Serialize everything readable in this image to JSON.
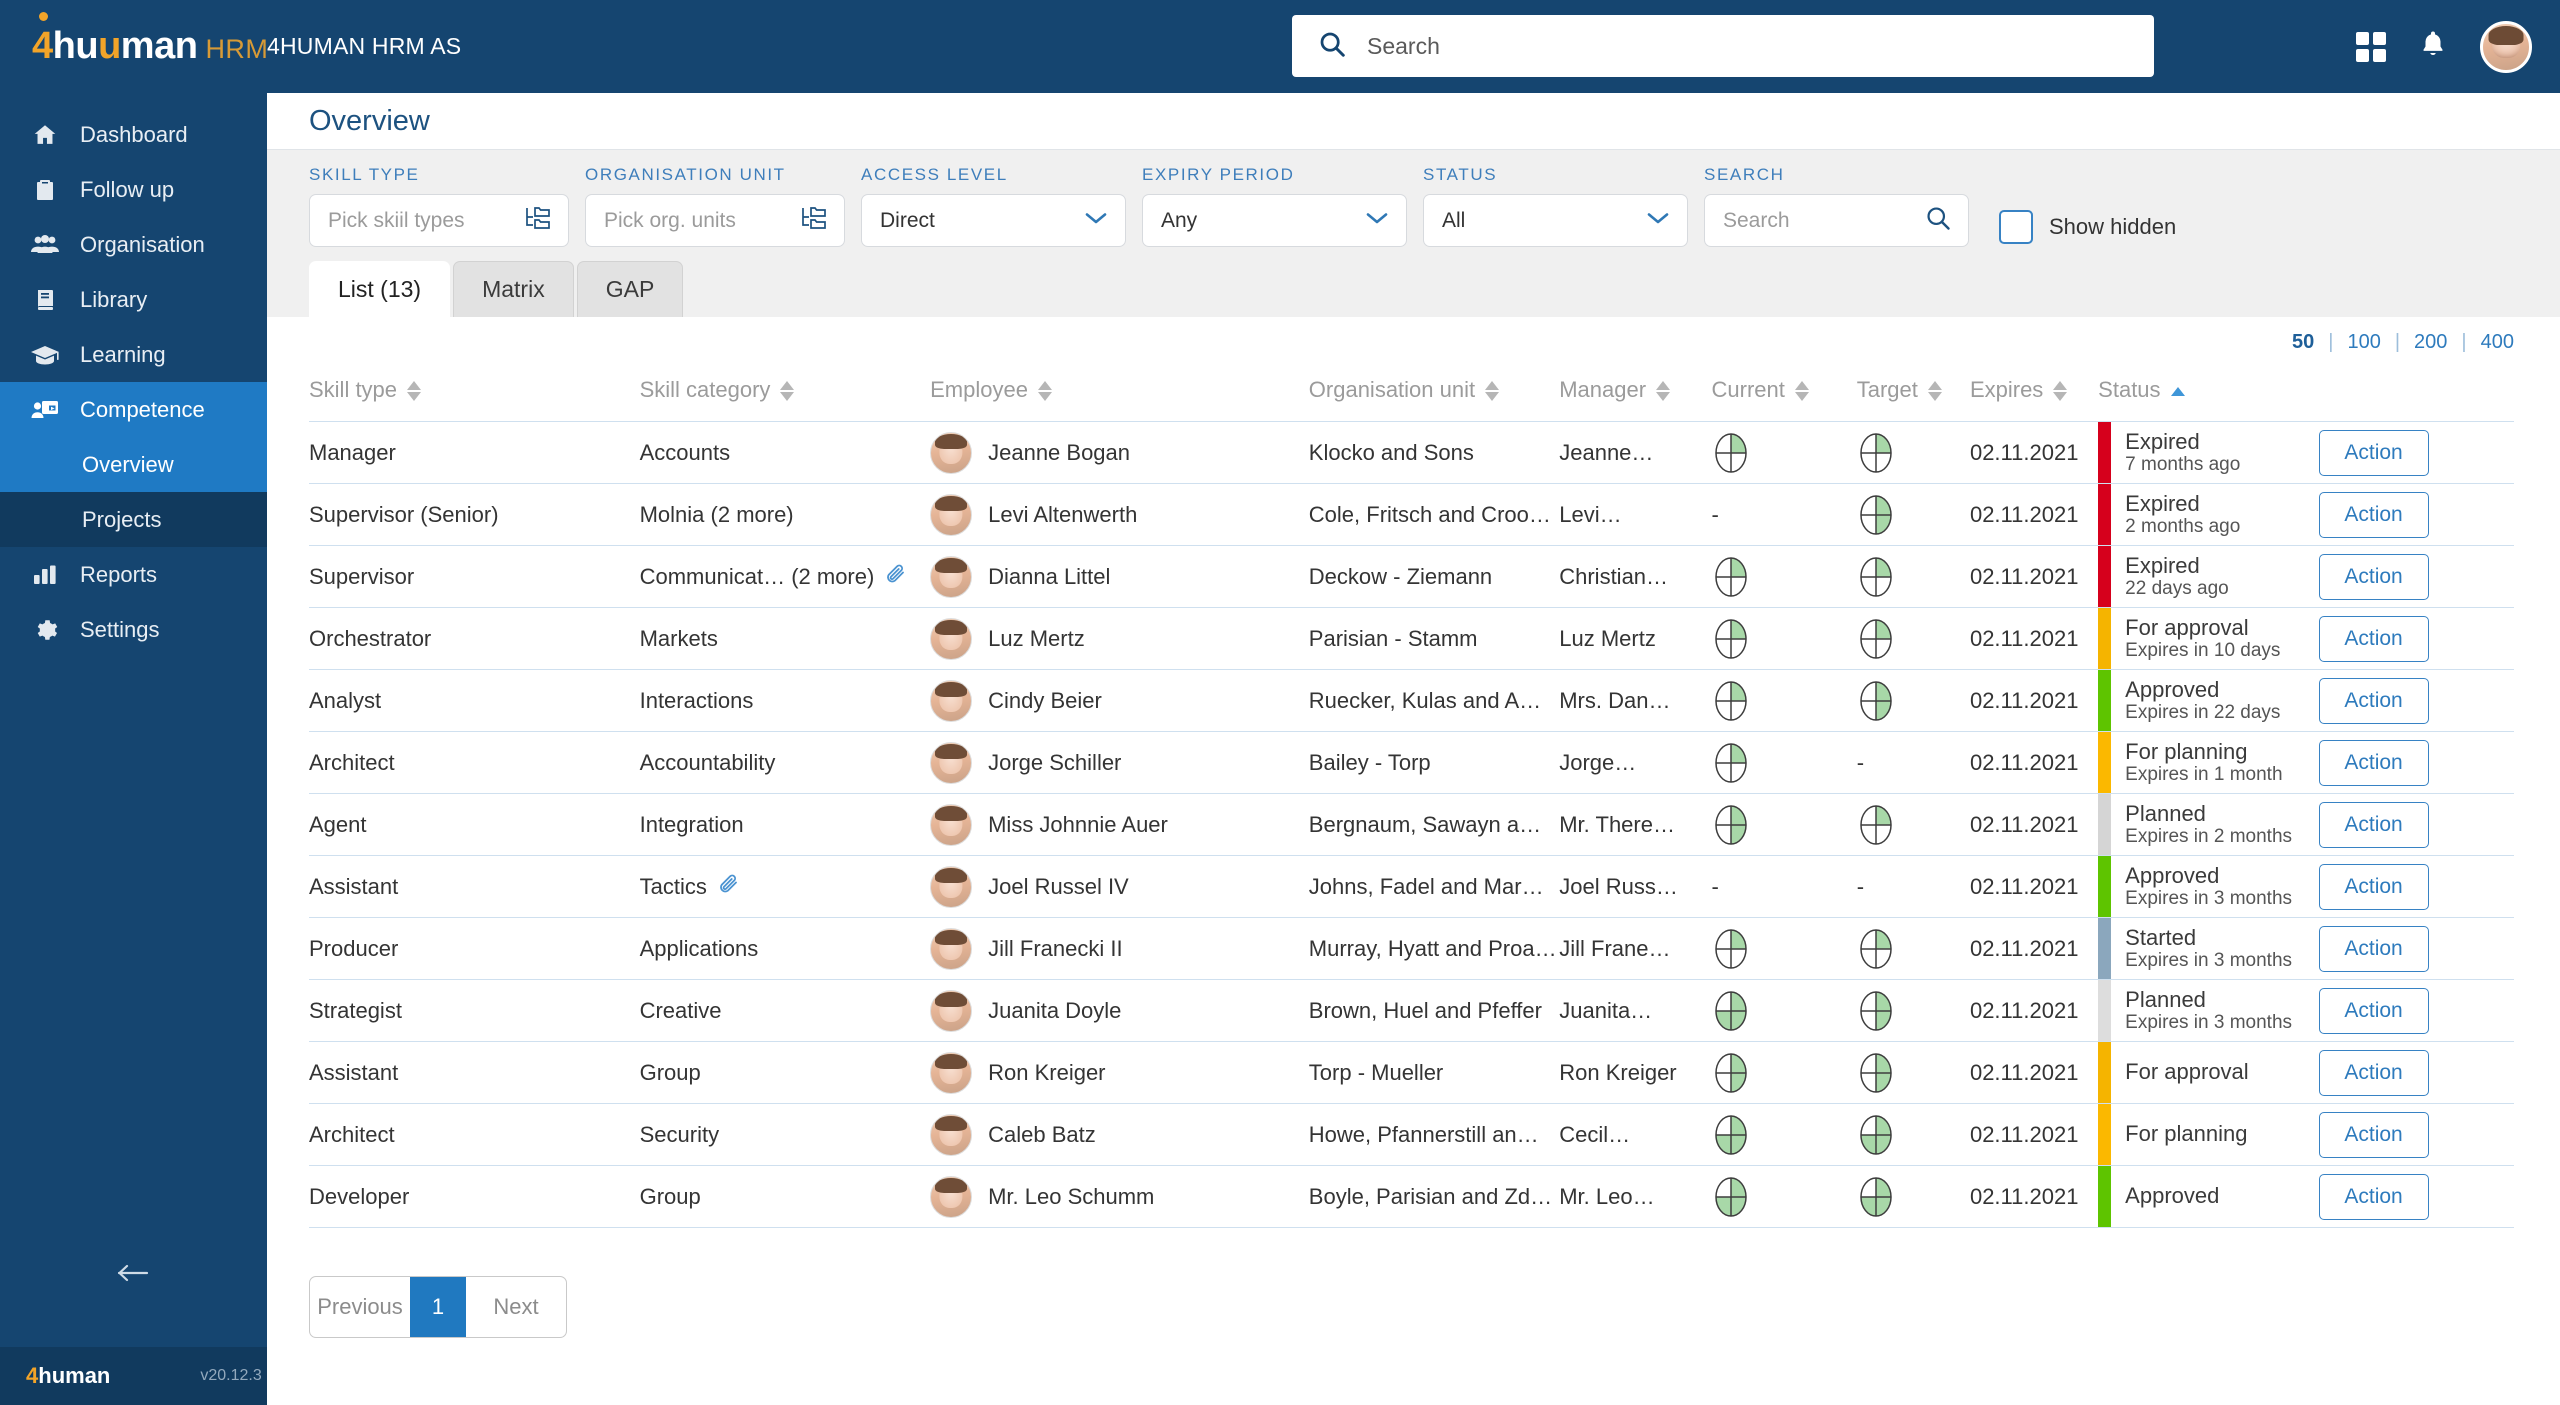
{
  "topbar": {
    "logo": {
      "four": "4",
      "hu": "hu",
      "u": "u",
      "man": "man",
      "hrm": "HRM"
    },
    "company": "4HUMAN HRM AS",
    "search_placeholder": "Search",
    "search_icon": "search-icon",
    "apps_icon": "grid-apps-icon",
    "bell_icon": "notification-bell-icon",
    "avatar": "user-avatar"
  },
  "sidebar": {
    "items": [
      {
        "label": "Dashboard",
        "icon": "home-icon",
        "active": false
      },
      {
        "label": "Follow up",
        "icon": "clipboard-icon",
        "active": false
      },
      {
        "label": "Organisation",
        "icon": "people-icon",
        "active": false
      },
      {
        "label": "Library",
        "icon": "book-icon",
        "active": false
      },
      {
        "label": "Learning",
        "icon": "graduation-cap-icon",
        "active": false
      },
      {
        "label": "Competence",
        "icon": "competence-icon",
        "active": true
      }
    ],
    "sub_items": [
      {
        "label": "Overview",
        "active": true
      },
      {
        "label": "Projects",
        "active": false
      }
    ],
    "items_after": [
      {
        "label": "Reports",
        "icon": "bar-chart-icon",
        "active": false
      },
      {
        "label": "Settings",
        "icon": "gear-icon",
        "active": false
      }
    ],
    "collapse_icon": "arrow-left-icon",
    "footer": {
      "logo_four": "4",
      "logo_human": "human",
      "version": "v20.12.3"
    }
  },
  "page": {
    "title": "Overview"
  },
  "filters": [
    {
      "label": "SKILL TYPE",
      "type": "picker",
      "placeholder": "Pick skiil types",
      "value": "",
      "icon": "tree-folder-icon",
      "name": "skill-type-filter"
    },
    {
      "label": "ORGANISATION UNIT",
      "type": "picker",
      "placeholder": "Pick org. units",
      "value": "",
      "icon": "tree-folder-icon",
      "name": "organisation-unit-filter"
    },
    {
      "label": "ACCESS LEVEL",
      "type": "select",
      "value": "Direct",
      "icon": "chevron-down-icon",
      "name": "access-level-filter"
    },
    {
      "label": "EXPIRY PERIOD",
      "type": "select",
      "value": "Any",
      "icon": "chevron-down-icon",
      "name": "expiry-period-filter"
    },
    {
      "label": "STATUS",
      "type": "select",
      "value": "All",
      "icon": "chevron-down-icon",
      "name": "status-filter"
    },
    {
      "label": "SEARCH",
      "type": "search",
      "placeholder": "Search",
      "value": "",
      "icon": "search-icon",
      "name": "search-filter"
    }
  ],
  "show_hidden": {
    "label": "Show hidden",
    "checked": false
  },
  "tabs": [
    {
      "label": "List (13)",
      "active": true
    },
    {
      "label": "Matrix",
      "active": false
    },
    {
      "label": "GAP",
      "active": false
    }
  ],
  "page_sizes": {
    "options": [
      "50",
      "100",
      "200",
      "400"
    ],
    "selected": "50",
    "separator": "|"
  },
  "table": {
    "columns": [
      {
        "label": "Skill type",
        "sort": "none"
      },
      {
        "label": "Skill category",
        "sort": "none"
      },
      {
        "label": "Employee",
        "sort": "none"
      },
      {
        "label": "Organisation unit",
        "sort": "none"
      },
      {
        "label": "Manager",
        "sort": "none"
      },
      {
        "label": "Current",
        "sort": "none"
      },
      {
        "label": "Target",
        "sort": "none"
      },
      {
        "label": "Expires",
        "sort": "none"
      },
      {
        "label": "Status",
        "sort": "asc"
      },
      {
        "label": "",
        "sort": "none"
      }
    ],
    "action_label": "Action",
    "rows": [
      {
        "skill_type": "Manager",
        "skill_category": "Accounts",
        "has_attachment": false,
        "employee": "Jeanne Bogan",
        "org_unit": "Klocko and Sons",
        "manager": "Jeanne…",
        "current": 1,
        "target": 1,
        "expires": "02.11.2021",
        "status": "Expired",
        "status_sub": "7 months ago",
        "status_color": "#d6001c"
      },
      {
        "skill_type": "Supervisor (Senior)",
        "skill_category": "Molnia (2 more)",
        "has_attachment": false,
        "employee": "Levi Altenwerth",
        "org_unit": "Cole, Fritsch and Croo…",
        "manager": "Levi…",
        "current": null,
        "target": 2,
        "expires": "02.11.2021",
        "status": "Expired",
        "status_sub": "2 months ago",
        "status_color": "#d6001c"
      },
      {
        "skill_type": "Supervisor",
        "skill_category": "Communicat… (2 more)",
        "has_attachment": true,
        "employee": "Dianna Littel",
        "org_unit": "Deckow - Ziemann",
        "manager": "Christian…",
        "current": 1,
        "target": 1,
        "expires": "02.11.2021",
        "status": "Expired",
        "status_sub": "22 days ago",
        "status_color": "#d6001c"
      },
      {
        "skill_type": "Orchestrator",
        "skill_category": "Markets",
        "has_attachment": false,
        "employee": "Luz Mertz",
        "org_unit": "Parisian - Stamm",
        "manager": "Luz Mertz",
        "current": 1,
        "target": 1,
        "expires": "02.11.2021",
        "status": "For approval",
        "status_sub": "Expires in 10 days",
        "status_color": "#f5b400"
      },
      {
        "skill_type": "Analyst",
        "skill_category": "Interactions",
        "has_attachment": false,
        "employee": "Cindy Beier",
        "org_unit": "Ruecker, Kulas and A…",
        "manager": "Mrs. Dan…",
        "current": 1,
        "target": 2,
        "expires": "02.11.2021",
        "status": "Approved",
        "status_sub": "Expires in 22 days",
        "status_color": "#5ec400"
      },
      {
        "skill_type": "Architect",
        "skill_category": "Accountability",
        "has_attachment": false,
        "employee": "Jorge Schiller",
        "org_unit": "Bailey - Torp",
        "manager": "Jorge…",
        "current": 1,
        "target": null,
        "expires": "02.11.2021",
        "status": "For planning",
        "status_sub": "Expires in 1 month",
        "status_color": "#fbb800"
      },
      {
        "skill_type": "Agent",
        "skill_category": "Integration",
        "has_attachment": false,
        "employee": "Miss Johnnie Auer",
        "org_unit": "Bergnaum, Sawayn a…",
        "manager": "Mr. There…",
        "current": 2,
        "target": 1,
        "expires": "02.11.2021",
        "status": "Planned",
        "status_sub": "Expires in 2 months",
        "status_color": "#d5d5d5"
      },
      {
        "skill_type": "Assistant",
        "skill_category": "Tactics",
        "has_attachment": true,
        "employee": "Joel Russel IV",
        "org_unit": "Johns, Fadel and Mar…",
        "manager": "Joel Russ…",
        "current": null,
        "target": null,
        "expires": "02.11.2021",
        "status": "Approved",
        "status_sub": "Expires in 3 months",
        "status_color": "#5ec400"
      },
      {
        "skill_type": "Producer",
        "skill_category": "Applications",
        "has_attachment": false,
        "employee": "Jill Franecki II",
        "org_unit": "Murray, Hyatt and Proa…",
        "manager": "Jill Frane…",
        "current": 1,
        "target": 1,
        "expires": "02.11.2021",
        "status": "Started",
        "status_sub": "Expires in 3 months",
        "status_color": "#8ba7bd"
      },
      {
        "skill_type": "Strategist",
        "skill_category": "Creative",
        "has_attachment": false,
        "employee": "Juanita Doyle",
        "org_unit": "Brown, Huel and Pfeffer",
        "manager": "Juanita…",
        "current": 3,
        "target": 2,
        "expires": "02.11.2021",
        "status": "Planned",
        "status_sub": "Expires in 3 months",
        "status_color": "#dddddd"
      },
      {
        "skill_type": "Assistant",
        "skill_category": "Group",
        "has_attachment": false,
        "employee": "Ron Kreiger",
        "org_unit": "Torp - Mueller",
        "manager": "Ron Kreiger",
        "current": 2,
        "target": 2,
        "expires": "02.11.2021",
        "status": "For approval",
        "status_sub": "",
        "status_color": "#f5b400"
      },
      {
        "skill_type": "Architect",
        "skill_category": "Security",
        "has_attachment": false,
        "employee": "Caleb Batz",
        "org_unit": "Howe, Pfannerstill an…",
        "manager": "Cecil…",
        "current": 3,
        "target": 3,
        "expires": "02.11.2021",
        "status": "For planning",
        "status_sub": "",
        "status_color": "#fbb800"
      },
      {
        "skill_type": "Developer",
        "skill_category": "Group",
        "has_attachment": false,
        "employee": "Mr. Leo Schumm",
        "org_unit": "Boyle, Parisian and Zd…",
        "manager": "Mr. Leo…",
        "current": 3,
        "target": 3,
        "expires": "02.11.2021",
        "status": "Approved",
        "status_sub": "",
        "status_color": "#5ec400"
      }
    ]
  },
  "pagination": {
    "previous": "Previous",
    "page": "1",
    "next": "Next"
  },
  "colors": {
    "brand_dark": "#154570",
    "brand_blue": "#1f7ac4",
    "accent_orange": "#f2a429",
    "filter_label": "#3e7ebb",
    "gauge_fill": "#a8d8a8"
  }
}
